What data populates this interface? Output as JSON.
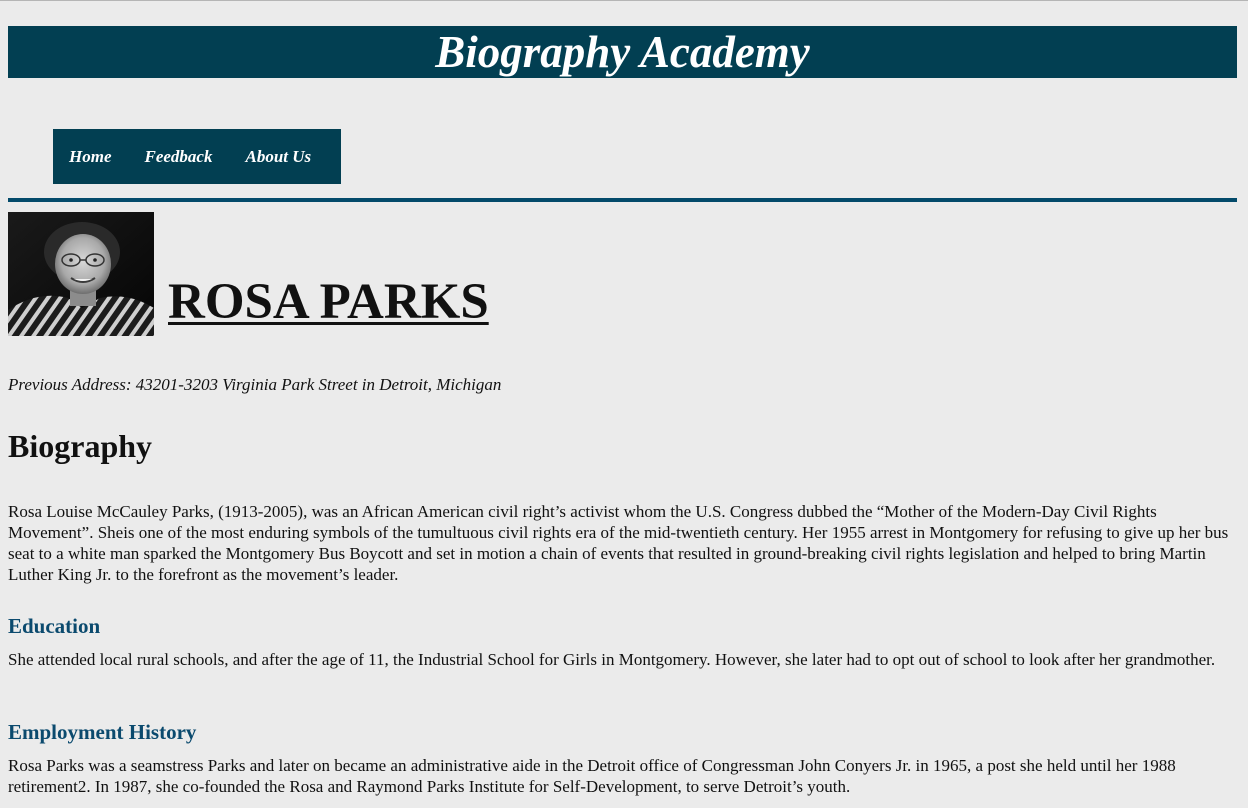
{
  "site": {
    "title": "Biography Academy"
  },
  "nav": {
    "items": [
      "Home",
      "Feedback",
      "About Us"
    ]
  },
  "profile": {
    "name": "ROSA PARKS",
    "address": "Previous Address: 43201-3203 Virginia Park Street in Detroit, Michigan"
  },
  "biography": {
    "heading": "Biography",
    "text": "Rosa Louise McCauley Parks, (1913-2005), was an African American civil right’s activist whom the U.S. Congress dubbed the “Mother of the Modern-Day Civil Rights Movement”. Sheis one of the most enduring symbols of the tumultuous civil rights era of the mid-twentieth century. Her 1955 arrest in Montgomery for refusing to give up her bus seat to a white man sparked the Montgomery Bus Boycott and set in motion a chain of events that resulted in ground-breaking civil rights legislation and helped to bring Martin Luther King Jr. to the forefront as the movement’s leader."
  },
  "education": {
    "heading": "Education",
    "text": "She attended local rural schools, and after the age of 11, the Industrial School for Girls in Montgomery. However, she later had to opt out of school to look after her grandmother."
  },
  "employment": {
    "heading": "Employment History",
    "text": "Rosa Parks was a seamstress Parks and later on became an administrative aide in the Detroit office of Congressman John Conyers Jr. in 1965, a post she held until her 1988 retirement2. In 1987, she co-founded the Rosa and Raymond Parks Institute for Self-Development, to serve Detroit’s youth."
  },
  "colors": {
    "banner": "#023f52",
    "rule": "#034a6a",
    "subheading": "#0b4a6e",
    "background": "#ebebeb"
  }
}
